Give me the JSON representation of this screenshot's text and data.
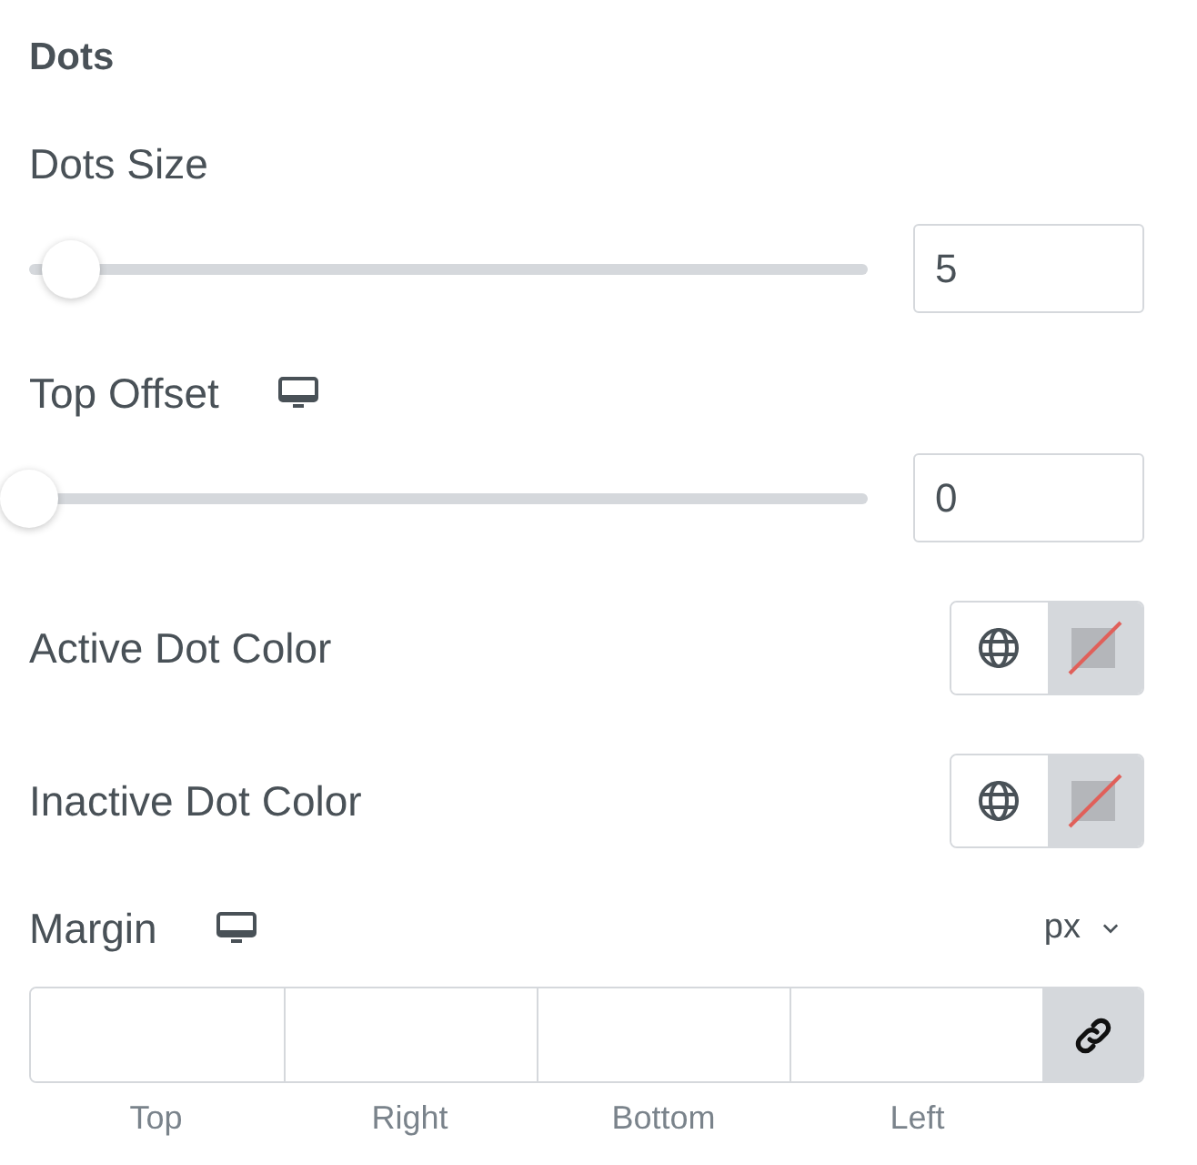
{
  "section": {
    "title": "Dots"
  },
  "controls": [
    {
      "kind": "slider",
      "label": "Dots Size",
      "responsive": false,
      "level": 0.05,
      "value": "5"
    },
    {
      "kind": "slider",
      "label": "Top Offset",
      "responsive": true,
      "level": 0,
      "value": "0"
    },
    {
      "kind": "color",
      "label": "Active Dot Color"
    },
    {
      "kind": "color",
      "label": "Inactive Dot Color"
    }
  ],
  "margin": {
    "label": "Margin",
    "responsive": true,
    "unit": "px",
    "sides": [
      {
        "label": "Top"
      },
      {
        "label": "Right"
      },
      {
        "label": "Bottom"
      },
      {
        "label": "Left"
      }
    ]
  }
}
